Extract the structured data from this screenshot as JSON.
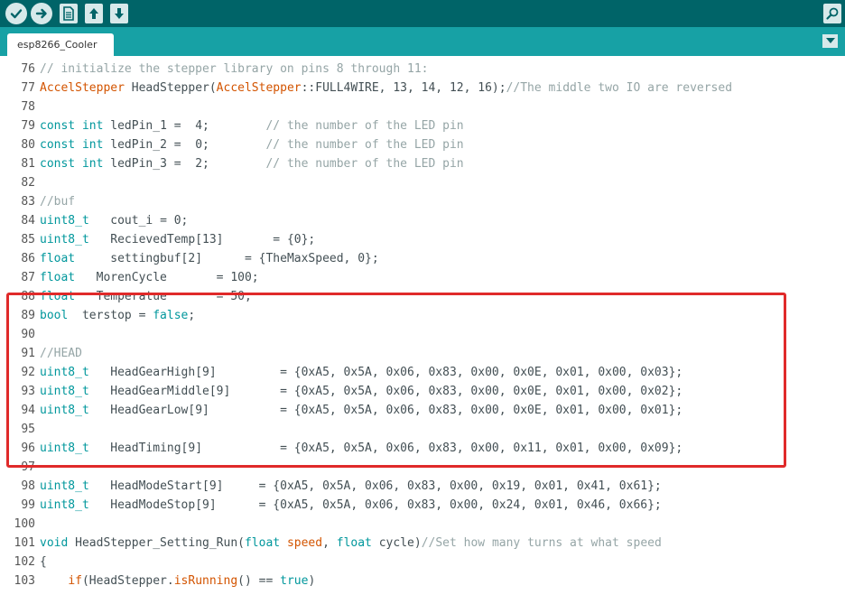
{
  "window": {
    "tab_label": "esp8266_Cooler"
  },
  "toolbar": {
    "buttons": [
      {
        "name": "verify-button",
        "icon": "check-icon"
      },
      {
        "name": "upload-button",
        "icon": "arrow-right-icon"
      },
      {
        "name": "new-button",
        "icon": "file-icon"
      },
      {
        "name": "open-button",
        "icon": "arrow-up-icon"
      },
      {
        "name": "save-button",
        "icon": "arrow-down-icon"
      }
    ],
    "serial_monitor_icon": "magnifier-icon"
  },
  "colors": {
    "toolbar_bg": "#006468",
    "tabbar_bg": "#17a1a5",
    "keyword_type": "#00979c",
    "keyword_class": "#d35400",
    "comment": "#95a5a6",
    "text": "#434f54",
    "highlight_box": "#e02a2a"
  },
  "code_lines": [
    {
      "n": "76",
      "tokens": [
        {
          "t": "// initialize the stepper library on pins 8 through 11:",
          "c": "cmt"
        }
      ]
    },
    {
      "n": "77",
      "tokens": [
        {
          "t": "AccelStepper",
          "c": "cls"
        },
        {
          "t": " HeadStepper(",
          "c": "txt"
        },
        {
          "t": "AccelStepper",
          "c": "cls"
        },
        {
          "t": "::FULL4WIRE, 13, 14, 12, 16);",
          "c": "txt"
        },
        {
          "t": "//The middle two IO are reversed",
          "c": "cmt"
        }
      ]
    },
    {
      "n": "78",
      "tokens": []
    },
    {
      "n": "79",
      "tokens": [
        {
          "t": "const",
          "c": "type"
        },
        {
          "t": " ",
          "c": "txt"
        },
        {
          "t": "int",
          "c": "type"
        },
        {
          "t": " ledPin_1 =  4;        ",
          "c": "txt"
        },
        {
          "t": "// the number of the LED pin",
          "c": "cmt"
        }
      ]
    },
    {
      "n": "80",
      "tokens": [
        {
          "t": "const",
          "c": "type"
        },
        {
          "t": " ",
          "c": "txt"
        },
        {
          "t": "int",
          "c": "type"
        },
        {
          "t": " ledPin_2 =  0;        ",
          "c": "txt"
        },
        {
          "t": "// the number of the LED pin",
          "c": "cmt"
        }
      ]
    },
    {
      "n": "81",
      "tokens": [
        {
          "t": "const",
          "c": "type"
        },
        {
          "t": " ",
          "c": "txt"
        },
        {
          "t": "int",
          "c": "type"
        },
        {
          "t": " ledPin_3 =  2;        ",
          "c": "txt"
        },
        {
          "t": "// the number of the LED pin",
          "c": "cmt"
        }
      ]
    },
    {
      "n": "82",
      "tokens": []
    },
    {
      "n": "83",
      "tokens": [
        {
          "t": "//buf",
          "c": "cmt"
        }
      ]
    },
    {
      "n": "84",
      "tokens": [
        {
          "t": "uint8_t",
          "c": "type"
        },
        {
          "t": "   cout_i = 0;",
          "c": "txt"
        }
      ]
    },
    {
      "n": "85",
      "tokens": [
        {
          "t": "uint8_t",
          "c": "type"
        },
        {
          "t": "   RecievedTemp[13]       = {0};",
          "c": "txt"
        }
      ]
    },
    {
      "n": "86",
      "tokens": [
        {
          "t": "float",
          "c": "type"
        },
        {
          "t": "     settingbuf[2]      = {TheMaxSpeed, 0};",
          "c": "txt"
        }
      ]
    },
    {
      "n": "87",
      "tokens": [
        {
          "t": "float",
          "c": "type"
        },
        {
          "t": "   MorenCycle       = 100;",
          "c": "txt"
        }
      ]
    },
    {
      "n": "88",
      "tokens": [
        {
          "t": "float",
          "c": "type"
        },
        {
          "t": "   Temperatue       = 50;",
          "c": "txt"
        }
      ]
    },
    {
      "n": "89",
      "tokens": [
        {
          "t": "bool",
          "c": "type"
        },
        {
          "t": "  terstop = ",
          "c": "txt"
        },
        {
          "t": "false",
          "c": "type"
        },
        {
          "t": ";",
          "c": "txt"
        }
      ]
    },
    {
      "n": "90",
      "tokens": []
    },
    {
      "n": "91",
      "tokens": [
        {
          "t": "//HEAD",
          "c": "cmt"
        }
      ]
    },
    {
      "n": "92",
      "tokens": [
        {
          "t": "uint8_t",
          "c": "type"
        },
        {
          "t": "   HeadGearHigh[9]         = {0xA5, 0x5A, 0x06, 0x83, 0x00, 0x0E, 0x01, 0x00, 0x03};",
          "c": "txt"
        }
      ]
    },
    {
      "n": "93",
      "tokens": [
        {
          "t": "uint8_t",
          "c": "type"
        },
        {
          "t": "   HeadGearMiddle[9]       = {0xA5, 0x5A, 0x06, 0x83, 0x00, 0x0E, 0x01, 0x00, 0x02};",
          "c": "txt"
        }
      ]
    },
    {
      "n": "94",
      "tokens": [
        {
          "t": "uint8_t",
          "c": "type"
        },
        {
          "t": "   HeadGearLow[9]          = {0xA5, 0x5A, 0x06, 0x83, 0x00, 0x0E, 0x01, 0x00, 0x01};",
          "c": "txt"
        }
      ]
    },
    {
      "n": "95",
      "tokens": []
    },
    {
      "n": "96",
      "tokens": [
        {
          "t": "uint8_t",
          "c": "type"
        },
        {
          "t": "   HeadTiming[9]           = {0xA5, 0x5A, 0x06, 0x83, 0x00, 0x11, 0x01, 0x00, 0x09};",
          "c": "txt"
        }
      ]
    },
    {
      "n": "97",
      "tokens": []
    },
    {
      "n": "98",
      "tokens": [
        {
          "t": "uint8_t",
          "c": "type"
        },
        {
          "t": "   HeadModeStart[9]     = {0xA5, 0x5A, 0x06, 0x83, 0x00, 0x19, 0x01, 0x41, 0x61};",
          "c": "txt"
        }
      ]
    },
    {
      "n": "99",
      "tokens": [
        {
          "t": "uint8_t",
          "c": "type"
        },
        {
          "t": "   HeadModeStop[9]      = {0xA5, 0x5A, 0x06, 0x83, 0x00, 0x24, 0x01, 0x46, 0x66};",
          "c": "txt"
        }
      ]
    },
    {
      "n": "100",
      "tokens": []
    },
    {
      "n": "101",
      "tokens": [
        {
          "t": "void",
          "c": "type"
        },
        {
          "t": " HeadStepper_Setting_Run(",
          "c": "txt"
        },
        {
          "t": "float",
          "c": "type"
        },
        {
          "t": " ",
          "c": "txt"
        },
        {
          "t": "speed",
          "c": "fn"
        },
        {
          "t": ", ",
          "c": "txt"
        },
        {
          "t": "float",
          "c": "type"
        },
        {
          "t": " cycle)",
          "c": "txt"
        },
        {
          "t": "//Set how many turns at what speed",
          "c": "cmt"
        }
      ]
    },
    {
      "n": "102",
      "tokens": [
        {
          "t": "{",
          "c": "txt"
        }
      ]
    },
    {
      "n": "103",
      "tokens": [
        {
          "t": "    ",
          "c": "txt"
        },
        {
          "t": "if",
          "c": "fn"
        },
        {
          "t": "(HeadStepper.",
          "c": "txt"
        },
        {
          "t": "isRunning",
          "c": "fn"
        },
        {
          "t": "() == ",
          "c": "txt"
        },
        {
          "t": "true",
          "c": "type"
        },
        {
          "t": ")",
          "c": "txt"
        }
      ]
    }
  ]
}
